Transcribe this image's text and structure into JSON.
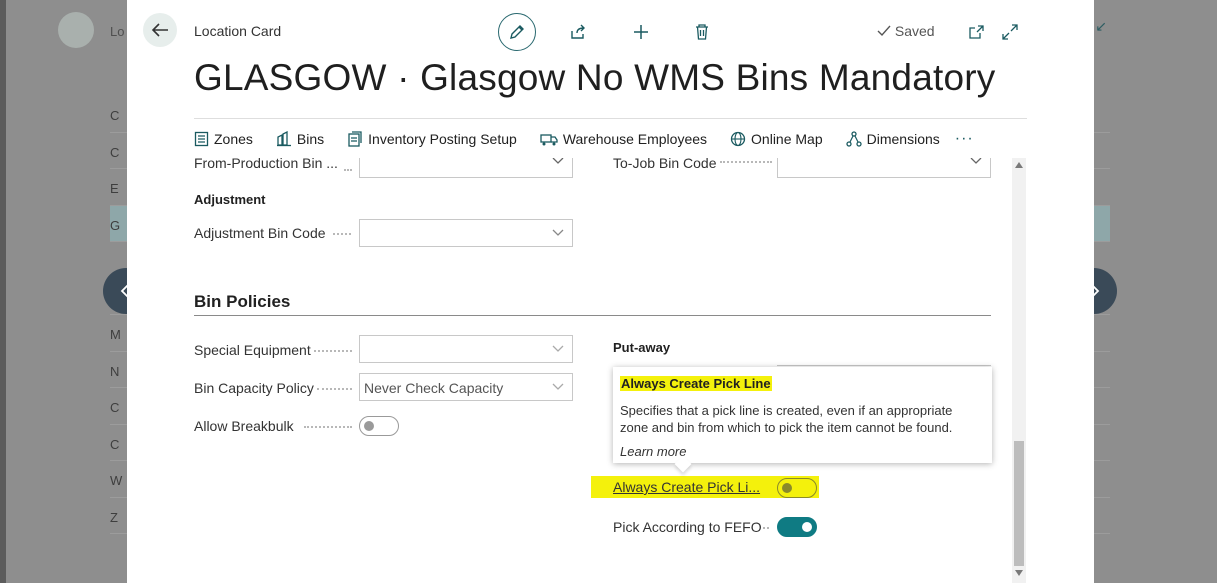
{
  "background": {
    "title_fragment": "Lo",
    "row_fragments": [
      "C",
      "C",
      "E",
      "G",
      "",
      "M",
      "M",
      "N",
      "C",
      "C",
      "W",
      "Z"
    ]
  },
  "header": {
    "card_label": "Location Card",
    "saved_label": "Saved",
    "page_title": "GLASGOW · Glasgow No WMS Bins Mandatory",
    "icons": [
      "back-arrow-icon",
      "pencil-icon",
      "share-icon",
      "plus-icon",
      "trash-icon",
      "checkmark-icon",
      "open-in-new-window-icon",
      "expand-icon"
    ]
  },
  "actionbar": {
    "items": [
      {
        "label": "Zones",
        "icon": "zones-icon"
      },
      {
        "label": "Bins",
        "icon": "bins-icon"
      },
      {
        "label": "Inventory Posting Setup",
        "icon": "setup-icon"
      },
      {
        "label": "Warehouse Employees",
        "icon": "employees-icon"
      },
      {
        "label": "Online Map",
        "icon": "globe-icon"
      },
      {
        "label": "Dimensions",
        "icon": "dimensions-icon"
      }
    ],
    "more": "···"
  },
  "form": {
    "from_production_label": "From-Production Bin ...",
    "to_job_label": "To-Job Bin Code",
    "adjustment_heading": "Adjustment",
    "adjustment_bin_label": "Adjustment Bin Code",
    "bin_policies_title": "Bin Policies",
    "special_equipment_label": "Special Equipment",
    "bin_capacity_label": "Bin Capacity Policy",
    "bin_capacity_value": "Never Check Capacity",
    "allow_breakbulk_label": "Allow Breakbulk",
    "allow_breakbulk_on": false,
    "putaway_heading": "Put-away",
    "always_create_pick_label": "Always Create Pick Li...",
    "always_create_pick_on": false,
    "pick_fefo_label": "Pick According to FEFO",
    "pick_fefo_on": true
  },
  "tooltip": {
    "title": "Always Create Pick Line",
    "body": "Specifies that a pick line is created, even if an appropriate zone and bin from which to pick the item cannot be found.",
    "learn_more": "Learn more"
  },
  "colors": {
    "accent": "#0f7b83",
    "highlight": "#f4f10c",
    "nav_circle": "#3a4a58"
  }
}
